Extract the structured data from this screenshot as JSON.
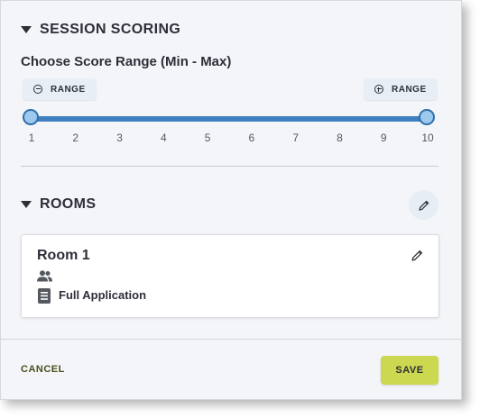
{
  "scoring": {
    "section_title": "SESSION SCORING",
    "subtitle": "Choose Score Range (Min - Max)",
    "decrease_label": "RANGE",
    "increase_label": "RANGE",
    "range_min": 1,
    "range_max": 10,
    "ticks": [
      "1",
      "2",
      "3",
      "4",
      "5",
      "6",
      "7",
      "8",
      "9",
      "10"
    ]
  },
  "rooms": {
    "section_title": "ROOMS",
    "items": [
      {
        "name": "Room 1",
        "application": "Full Application"
      }
    ]
  },
  "footer": {
    "cancel_label": "CANCEL",
    "save_label": "SAVE"
  },
  "colors": {
    "accent": "#3f7fbf",
    "save": "#ccd84f",
    "cancel_text": "#4a4f1a"
  },
  "icons": {
    "collapse": "caret-down-icon",
    "decrease": "minus-circle-icon",
    "increase": "plus-circle-icon",
    "edit": "pencil-icon",
    "people": "people-icon",
    "document": "document-icon"
  }
}
